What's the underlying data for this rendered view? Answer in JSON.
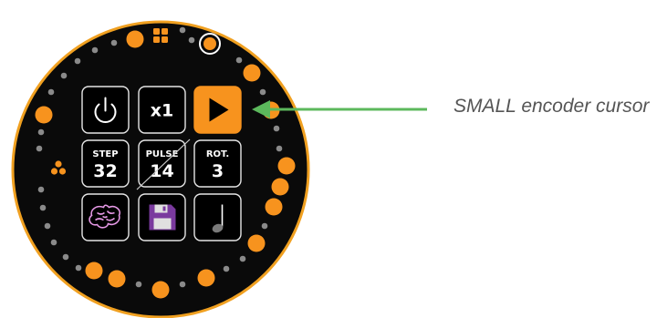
{
  "colors": {
    "device_bg": "#0a0a0a",
    "device_rim": "#f0a020",
    "accent": "#f7931e",
    "dot_inactive": "#8a8a8a",
    "button_border": "#e6e6e6",
    "brain": "#e699e6",
    "floppy": "#7a3a9e",
    "arrow": "#5cb85c",
    "callout_text": "#555555"
  },
  "buttons": [
    {
      "name": "power-button",
      "icon": "power-icon",
      "label": "",
      "value": ""
    },
    {
      "name": "multiplier-button",
      "icon": "",
      "label": "x1",
      "value": ""
    },
    {
      "name": "play-button",
      "icon": "play-icon",
      "label": "",
      "value": "",
      "highlighted": true
    },
    {
      "name": "step-button",
      "icon": "",
      "label": "STEP",
      "value": "32"
    },
    {
      "name": "pulse-button",
      "icon": "",
      "label": "PULSE",
      "value": "14"
    },
    {
      "name": "rotation-button",
      "icon": "",
      "label": "ROT.",
      "value": "3"
    },
    {
      "name": "brain-button",
      "icon": "brain-icon",
      "label": "",
      "value": ""
    },
    {
      "name": "save-button",
      "icon": "floppy-icon",
      "label": "",
      "value": ""
    },
    {
      "name": "note-button",
      "icon": "note-icon",
      "label": "",
      "value": ""
    }
  ],
  "ring_icons": [
    "grid-icon",
    "cursor-ring-icon",
    "shapes-icon"
  ],
  "callout": {
    "text": "SMALL encoder cursor"
  }
}
